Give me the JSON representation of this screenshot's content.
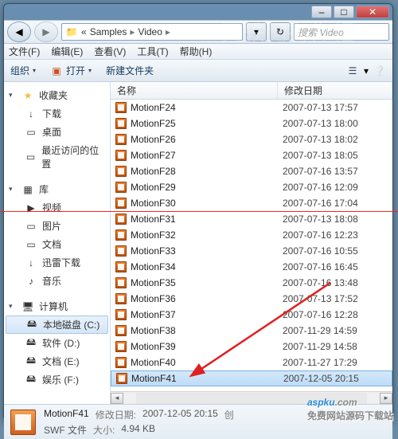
{
  "window": {
    "min": "–",
    "max": "□",
    "close": "✕"
  },
  "nav": {
    "crumbs": [
      "«",
      "Samples",
      "Video"
    ],
    "sep": "▸",
    "search_placeholder": "搜索 Video"
  },
  "menu": {
    "file": "文件(F)",
    "edit": "编辑(E)",
    "view": "查看(V)",
    "tools": "工具(T)",
    "help": "帮助(H)"
  },
  "toolbar": {
    "organize": "组织",
    "open": "打开",
    "newfolder": "新建文件夹",
    "dd": "▾"
  },
  "tree": {
    "fav": {
      "label": "收藏夹",
      "icon": "★",
      "items": [
        {
          "label": "下载",
          "icon": "↓"
        },
        {
          "label": "桌面",
          "icon": "▭"
        },
        {
          "label": "最近访问的位置",
          "icon": "▭"
        }
      ]
    },
    "lib": {
      "label": "库",
      "icon": "▦",
      "items": [
        {
          "label": "视频",
          "icon": "▶"
        },
        {
          "label": "图片",
          "icon": "▭"
        },
        {
          "label": "文档",
          "icon": "▭"
        },
        {
          "label": "迅雷下载",
          "icon": "↓"
        },
        {
          "label": "音乐",
          "icon": "♪"
        }
      ]
    },
    "pc": {
      "label": "计算机",
      "icon": "🖥",
      "items": [
        {
          "label": "本地磁盘 (C:)",
          "icon": "🖴",
          "sel": true
        },
        {
          "label": "软件 (D:)",
          "icon": "🖴"
        },
        {
          "label": "文档 (E:)",
          "icon": "🖴"
        },
        {
          "label": "娱乐 (F:)",
          "icon": "🖴"
        }
      ]
    }
  },
  "columns": {
    "name": "名称",
    "date": "修改日期"
  },
  "files": [
    {
      "n": "MotionF24",
      "d": "2007-07-13 17:57"
    },
    {
      "n": "MotionF25",
      "d": "2007-07-13 18:00"
    },
    {
      "n": "MotionF26",
      "d": "2007-07-13 18:02"
    },
    {
      "n": "MotionF27",
      "d": "2007-07-13 18:05"
    },
    {
      "n": "MotionF28",
      "d": "2007-07-16 13:57"
    },
    {
      "n": "MotionF29",
      "d": "2007-07-16 12:09"
    },
    {
      "n": "MotionF30",
      "d": "2007-07-16 17:04"
    },
    {
      "n": "MotionF31",
      "d": "2007-07-13 18:08"
    },
    {
      "n": "MotionF32",
      "d": "2007-07-16 12:23"
    },
    {
      "n": "MotionF33",
      "d": "2007-07-16 10:55"
    },
    {
      "n": "MotionF34",
      "d": "2007-07-16 16:45"
    },
    {
      "n": "MotionF35",
      "d": "2007-07-16 13:48"
    },
    {
      "n": "MotionF36",
      "d": "2007-07-13 17:52"
    },
    {
      "n": "MotionF37",
      "d": "2007-07-16 12:28"
    },
    {
      "n": "MotionF38",
      "d": "2007-11-29 14:59"
    },
    {
      "n": "MotionF39",
      "d": "2007-11-29 14:58"
    },
    {
      "n": "MotionF40",
      "d": "2007-11-27 17:29"
    },
    {
      "n": "MotionF41",
      "d": "2007-12-05 20:15",
      "sel": true
    }
  ],
  "details": {
    "name": "MotionF41",
    "type": "SWF 文件",
    "mod_label": "修改日期:",
    "mod": "2007-12-05 20:15",
    "size_label": "大小:",
    "size": "4.94 KB",
    "create_label": "创"
  },
  "watermark": "aspku",
  "watermark_sub": "免费网站源码下载站"
}
